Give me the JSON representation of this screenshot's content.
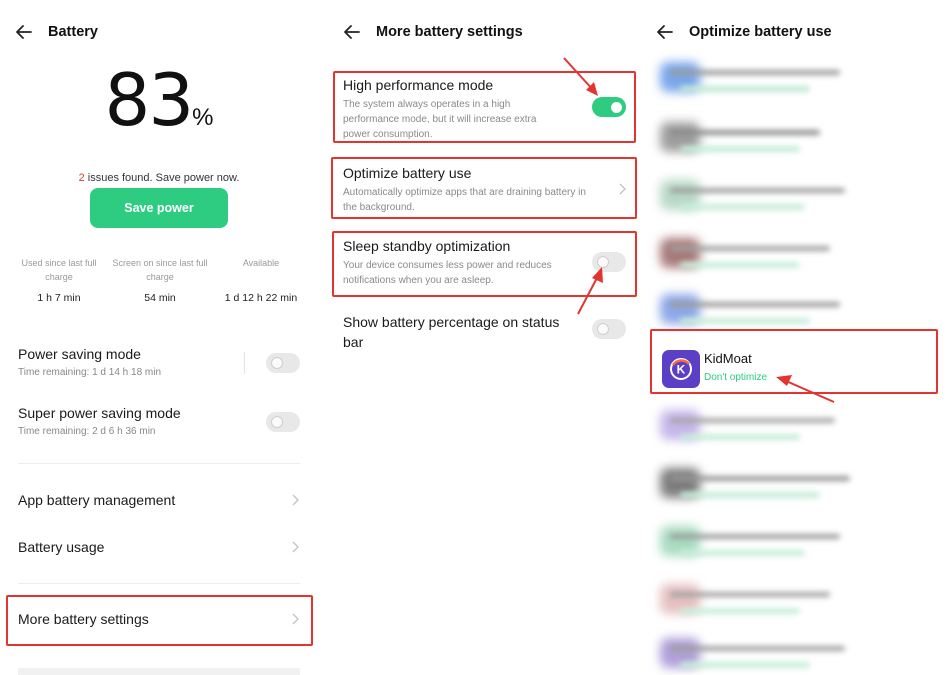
{
  "panel1": {
    "title": "Battery",
    "percent": "83",
    "percent_sign": "%",
    "issues_count": "2",
    "issues_text": " issues found. Save power now.",
    "save_button": "Save power",
    "stats": [
      {
        "label": "Used since last full charge",
        "value": "1 h 7 min"
      },
      {
        "label": "Screen on since last full charge",
        "value": "54 min"
      },
      {
        "label": "Available",
        "value": "1 d 12 h 22 min"
      }
    ],
    "power_saving": {
      "title": "Power saving mode",
      "sub": "Time remaining:  1 d 14 h 18 min",
      "enabled": false
    },
    "super_power_saving": {
      "title": "Super power saving mode",
      "sub": "Time remaining:  2 d 6 h 36 min",
      "enabled": false
    },
    "app_battery_management": "App battery management",
    "battery_usage": "Battery usage",
    "more_battery_settings": "More battery settings"
  },
  "panel2": {
    "title": "More battery settings",
    "high_performance": {
      "title": "High performance mode",
      "desc": "The system always operates in a high performance mode, but it will increase extra power consumption.",
      "enabled": true
    },
    "optimize_battery": {
      "title": "Optimize battery use",
      "desc": "Automatically optimize apps that are draining battery in the background."
    },
    "sleep_standby": {
      "title": "Sleep standby optimization",
      "desc": "Your device consumes less power and reduces notifications when you are asleep.",
      "enabled": false
    },
    "show_percentage": {
      "title": "Show battery percentage on status bar",
      "enabled": false
    }
  },
  "panel3": {
    "title": "Optimize battery use",
    "app_name": "KidMoat",
    "app_status": "Don't optimize",
    "icon_letter": "K"
  },
  "colors": {
    "accent_green": "#2ecc80",
    "highlight_red": "#e3342f",
    "kidmoat_purple": "#5b3fc4"
  }
}
